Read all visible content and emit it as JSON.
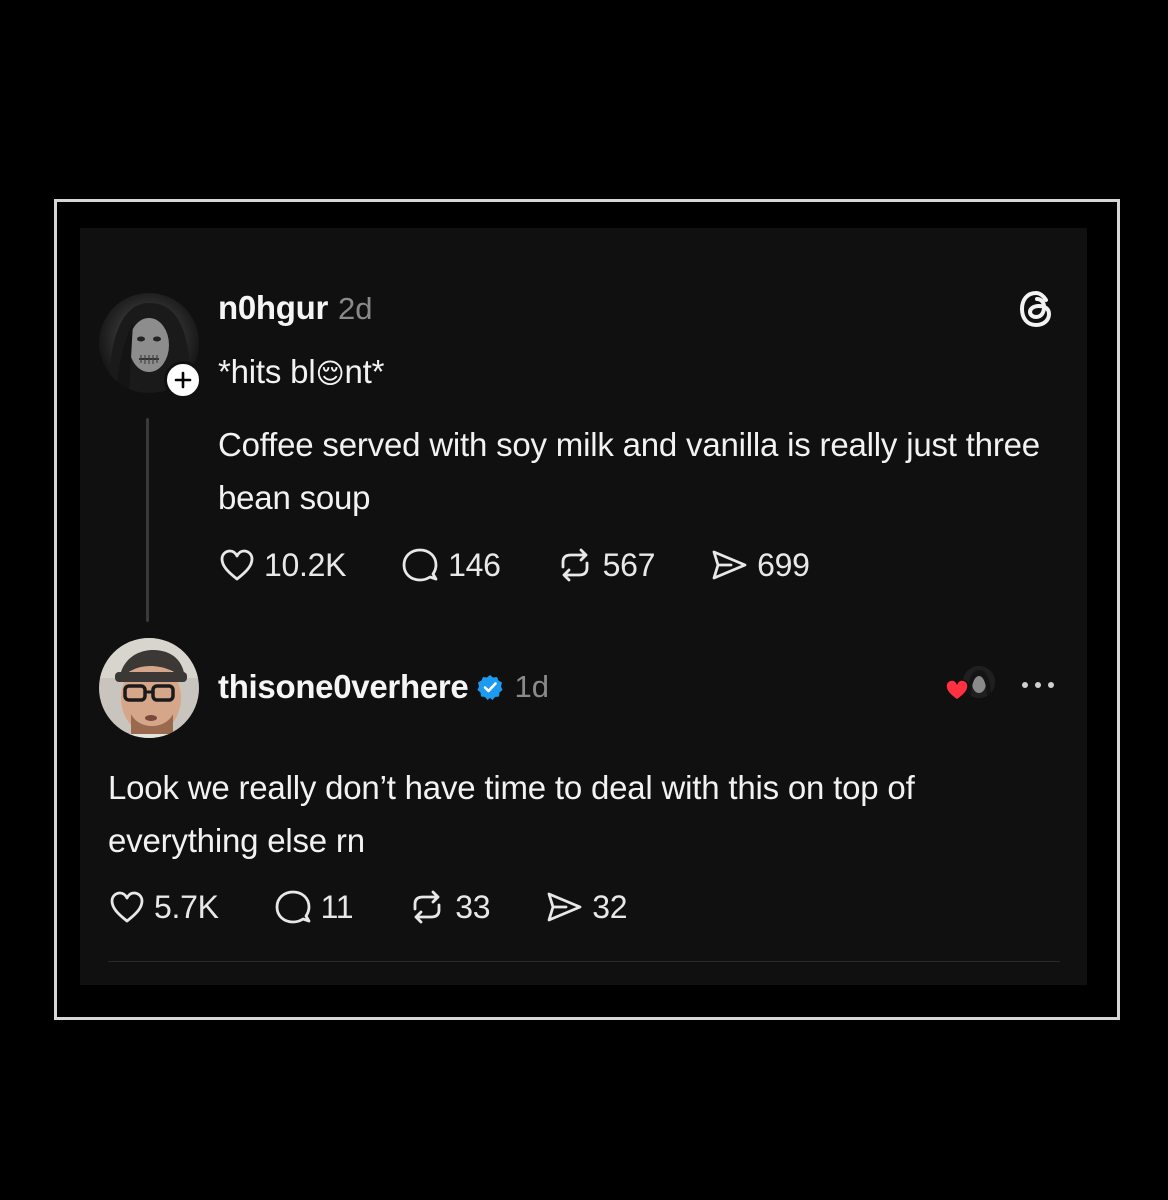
{
  "post": {
    "username": "n0hgur",
    "time": "2d",
    "line1_before": "*hits bl",
    "line1_emoji": "😌",
    "line1_after": "nt*",
    "body": "Coffee served with soy milk and vanilla is really just three bean soup",
    "likes": "10.2K",
    "replies": "146",
    "reposts": "567",
    "shares": "699"
  },
  "reply": {
    "username": "thisone0verhere",
    "time": "1d",
    "body": "Look we really don’t have time to deal with this on top of everything else rn",
    "likes": "5.7K",
    "replies": "11",
    "reposts": "33",
    "shares": "32"
  },
  "colors": {
    "background": "#000000",
    "card": "#101010",
    "text": "#f2f2f2",
    "muted": "#8a8a8a",
    "verified": "#1d9bf0",
    "heart_red": "#ff3040"
  },
  "icons": {
    "app": "threads-logo-icon",
    "like": "heart-icon",
    "reply": "comment-bubble-icon",
    "repost": "repost-icon",
    "share": "send-icon",
    "more": "more-dots-icon",
    "follow": "plus-icon",
    "verified": "verified-badge-icon"
  }
}
